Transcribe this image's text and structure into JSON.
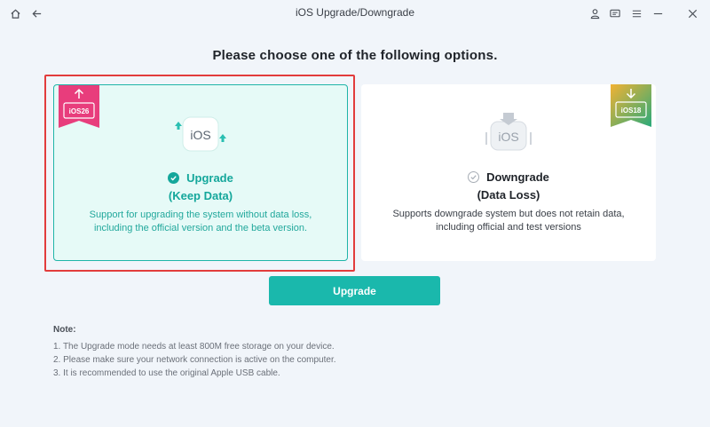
{
  "window": {
    "title": "iOS Upgrade/Downgrade",
    "icons": [
      "home-icon",
      "back-arrow-icon",
      "user-icon",
      "feedback-icon",
      "menu-icon",
      "minimize-icon",
      "close-icon"
    ]
  },
  "heading": "Please choose one of the following options.",
  "options": [
    {
      "badge": "iOS26",
      "graphic_text": "iOS",
      "title": "Upgrade",
      "subtitle": "(Keep Data)",
      "description": "Support for upgrading the system without data loss, including the official version and the beta version.",
      "selected": true
    },
    {
      "badge": "iOS18",
      "graphic_text": "iOS",
      "title": "Downgrade",
      "subtitle": "(Data Loss)",
      "description": "Supports downgrade system but does not retain data, including official and test versions",
      "selected": false
    }
  ],
  "action_button": "Upgrade",
  "notes": {
    "title": "Note:",
    "items": [
      "1.  The Upgrade mode needs at least 800M free storage on your device.",
      "2.  Please make sure your network connection is active on the computer.",
      "3.  It is recommended to use the original Apple USB cable."
    ]
  },
  "colors": {
    "accent": "#1ab8ac",
    "selected_card_bg": "#e6faf7",
    "highlight_border": "#e23c3c",
    "badge_upgrade": "#e83d7c",
    "badge_downgrade": "#2aaa7a"
  }
}
